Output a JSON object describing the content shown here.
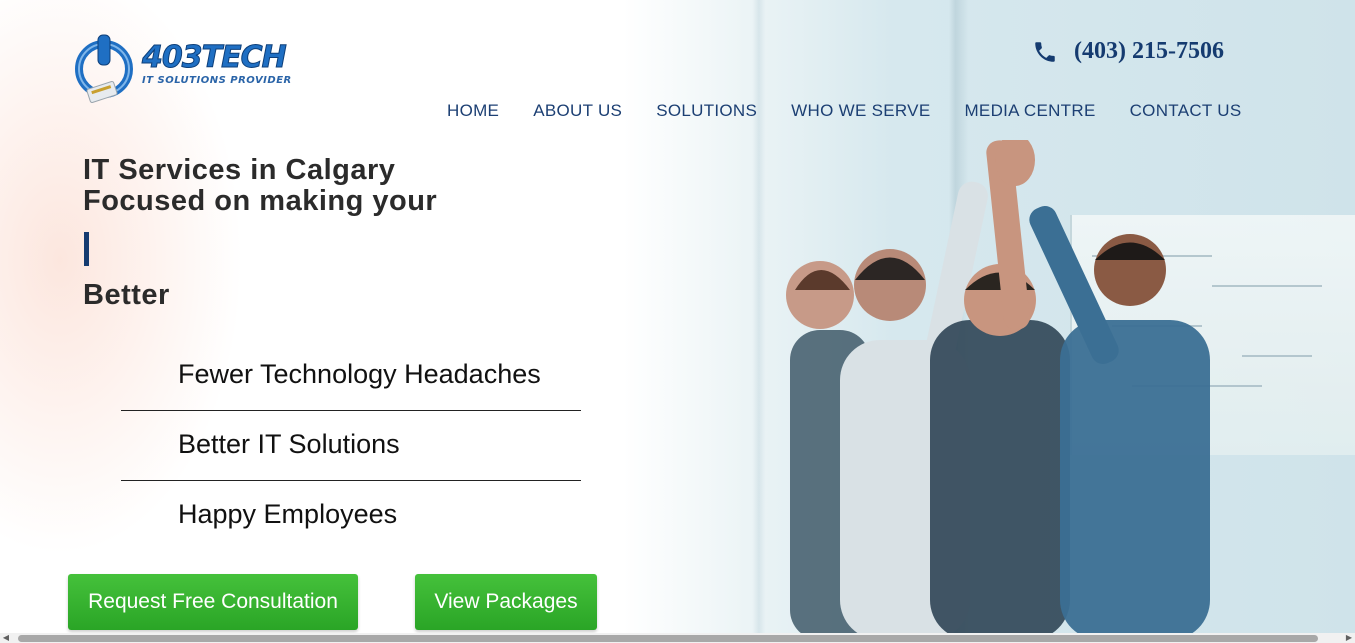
{
  "header": {
    "logo_text": "403TECH",
    "logo_tagline": "IT SOLUTIONS PROVIDER",
    "phone": "(403) 215-7506",
    "phone_icon": "phone-icon"
  },
  "nav": {
    "items": [
      {
        "label": "HOME"
      },
      {
        "label": "ABOUT US"
      },
      {
        "label": "SOLUTIONS"
      },
      {
        "label": "WHO WE SERVE"
      },
      {
        "label": "MEDIA CENTRE"
      },
      {
        "label": "CONTACT US"
      }
    ]
  },
  "hero": {
    "headline_line1": "IT Services in Calgary",
    "headline_line2": "Focused on making your",
    "rotating_word": "Better",
    "benefits": [
      {
        "text": "Fewer Technology Headaches"
      },
      {
        "text": "Better IT Solutions"
      },
      {
        "text": "Happy Employees"
      }
    ]
  },
  "buttons": {
    "consultation": "Request Free Consultation",
    "packages": "View Packages"
  },
  "colors": {
    "nav_text": "#1c3f73",
    "accent_green": "#2aa526",
    "brand_blue": "#1f6fc3",
    "phone_blue": "#153b70"
  }
}
